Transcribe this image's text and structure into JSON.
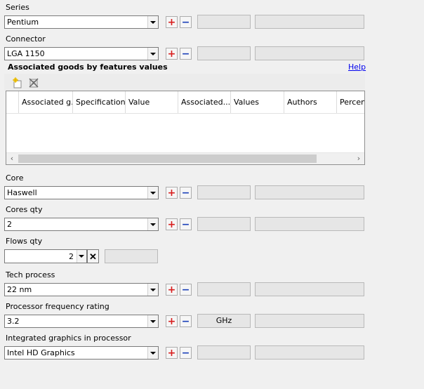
{
  "fields": {
    "series": {
      "label": "Series",
      "value": "Pentium"
    },
    "connector": {
      "label": "Connector",
      "value": "LGA 1150"
    },
    "core": {
      "label": "Core",
      "value": "Haswell"
    },
    "cores_qty": {
      "label": "Cores qty",
      "value": "2"
    },
    "flows_qty": {
      "label": "Flows qty",
      "value": "2"
    },
    "tech_process": {
      "label": "Tech process",
      "value": "22 nm"
    },
    "freq_rating": {
      "label": "Processor frequency rating",
      "value": "3.2",
      "unit": "GHz"
    },
    "igpu": {
      "label": "Integrated graphics in processor",
      "value": "Intel HD Graphics"
    }
  },
  "buttons": {
    "plus": "+",
    "minus": "−",
    "clear": "✕"
  },
  "associated": {
    "title": "Associated goods by features values",
    "help": "Help",
    "columns": [
      "Associated g..",
      "Specification",
      "Value",
      "Associated...",
      "Values",
      "Authors",
      "Percent"
    ]
  },
  "icons": {
    "add": "new-row-icon",
    "delete": "delete-row-icon"
  },
  "colors": {
    "plus": "#d81e1e",
    "minus": "#1a3fb8",
    "link": "#0000ee"
  }
}
